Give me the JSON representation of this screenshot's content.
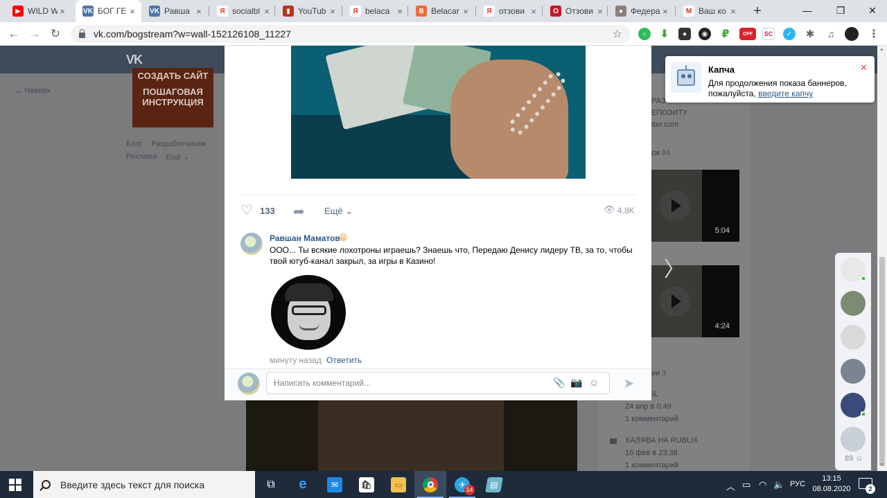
{
  "browser": {
    "tabs": [
      {
        "title": "WILD W",
        "icon": "youtube-icon",
        "color": "#ff0000",
        "glyph": "▶"
      },
      {
        "title": "БОГ ГЕ",
        "icon": "vk-icon",
        "color": "#4a76a8",
        "glyph": "VK",
        "active": true
      },
      {
        "title": "Равша",
        "icon": "vk-icon",
        "color": "#4a76a8",
        "glyph": "VK"
      },
      {
        "title": "socialbl",
        "icon": "yandex-icon",
        "color": "#ffffff",
        "glyph": "Я"
      },
      {
        "title": "YouTub",
        "icon": "socialblade-icon",
        "color": "#b9341f",
        "glyph": "▮"
      },
      {
        "title": "belaca",
        "icon": "yandex-icon",
        "color": "#ffffff",
        "glyph": "Я"
      },
      {
        "title": "Belacar",
        "icon": "belacar-icon",
        "color": "#ef6a3c",
        "glyph": "B"
      },
      {
        "title": "отзови",
        "icon": "yandex-icon",
        "color": "#ffffff",
        "glyph": "Я"
      },
      {
        "title": "Отзови",
        "icon": "otzovik-icon",
        "color": "#c4182b",
        "glyph": "O"
      },
      {
        "title": "Федера",
        "icon": "avatar-icon",
        "color": "#8a7f78",
        "glyph": "●"
      },
      {
        "title": "Ваш ко",
        "icon": "gmail-icon",
        "color": "#ffffff",
        "glyph": "M"
      }
    ],
    "url_host": "vk.com",
    "url_path": "/bogstream?w=wall-152126108_11227"
  },
  "vk_page": {
    "logo": "VK",
    "back_link": "Наверх",
    "banner_line1": "СОЗДАТЬ САЙТ",
    "banner_line2": "ПОШАГОВАЯ ИНСТРУКЦИЯ",
    "footer_links": [
      "Блог",
      "Разработчикам",
      "Реклама",
      "Ещё ⌄"
    ],
    "right_snippet_1": "РАЗ",
    "right_snippet_2": "ЕПОЗИТУ",
    "right_snippet_3": "tter.com",
    "videos_label": "си",
    "videos_count": "84",
    "video_durations": [
      "5:04",
      "4:24"
    ],
    "discussions_label": "ии",
    "discussions_count": "3",
    "discussions": [
      {
        "title": "A CSFAIL",
        "date": "24 апр в 0:49",
        "comments": "1 комментарий"
      },
      {
        "title": "ХАЛЯВА НА RUBLIX",
        "date": "16 фев в 23:38",
        "comments": "1 комментарий"
      }
    ],
    "friends_online_count": "89"
  },
  "post": {
    "likes": "133",
    "more_label": "Ещё",
    "views": "4.8K",
    "comment": {
      "author": "Равшан Маматов",
      "emoji": "😁",
      "text": "ООО... Ты всякие лохотроны играешь? Знаешь что, Передаю Денису лидеру ТВ, за то, чтобы твой ютуб-канал закрыл, за игры в Казино!",
      "time": "минуту назад",
      "reply_label": "Ответить"
    },
    "reply_placeholder": "Написать комментарий..."
  },
  "notification": {
    "title": "Капча",
    "text": "Для продолжения показа баннеров, пожалуйста,",
    "link": "введите капчу"
  },
  "taskbar": {
    "search_placeholder": "Введите здесь текст для поиска",
    "telegram_badge": "14",
    "language": "РУС",
    "time": "13:15",
    "date": "08.08.2020",
    "notifications_count": "2"
  }
}
